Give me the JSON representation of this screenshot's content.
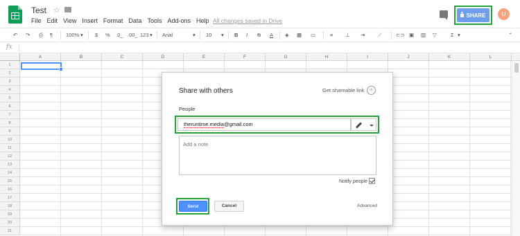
{
  "header": {
    "title": "Test",
    "menu": [
      "File",
      "Edit",
      "View",
      "Insert",
      "Format",
      "Data",
      "Tools",
      "Add-ons",
      "Help"
    ],
    "save_status": "All changes saved in Drive",
    "share_label": "SHARE",
    "avatar_initial": "U"
  },
  "toolbar": {
    "zoom": "100%",
    "currency": "$",
    "percent": "%",
    "decimal_decrease": ".0_",
    "decimal_increase": ".00_",
    "number_format": "123",
    "font": "Arial",
    "font_size": "10",
    "bold": "B",
    "italic": "I",
    "strikethrough": "S",
    "text_color": "A",
    "sum": "Σ"
  },
  "formula_bar": {
    "fx_label": "fx"
  },
  "grid": {
    "columns": [
      "A",
      "B",
      "C",
      "D",
      "E",
      "F",
      "G",
      "H",
      "I",
      "J",
      "K",
      "L"
    ],
    "rows": [
      "1",
      "2",
      "3",
      "4",
      "5",
      "6",
      "7",
      "8",
      "9",
      "10",
      "11",
      "12",
      "13",
      "14",
      "15",
      "16",
      "17",
      "18",
      "19",
      "20",
      "21"
    ]
  },
  "dialog": {
    "title": "Share with others",
    "shareable_link": "Get shareable link",
    "people_label": "People",
    "email_value": "theruntime.media@gmail.com",
    "email_underlined": "theruntime.media",
    "email_rest": "@gmail.com",
    "note_placeholder": "Add a note",
    "notify_label": "Notify people",
    "notify_checked": true,
    "send_label": "Send",
    "cancel_label": "Cancel",
    "advanced_label": "Advanced"
  },
  "colors": {
    "highlight_green": "#22a33a",
    "share_blue": "#6d9eeb",
    "send_blue": "#4d90fe",
    "sheets_green": "#0f9d58",
    "avatar": "#f4a47c"
  }
}
